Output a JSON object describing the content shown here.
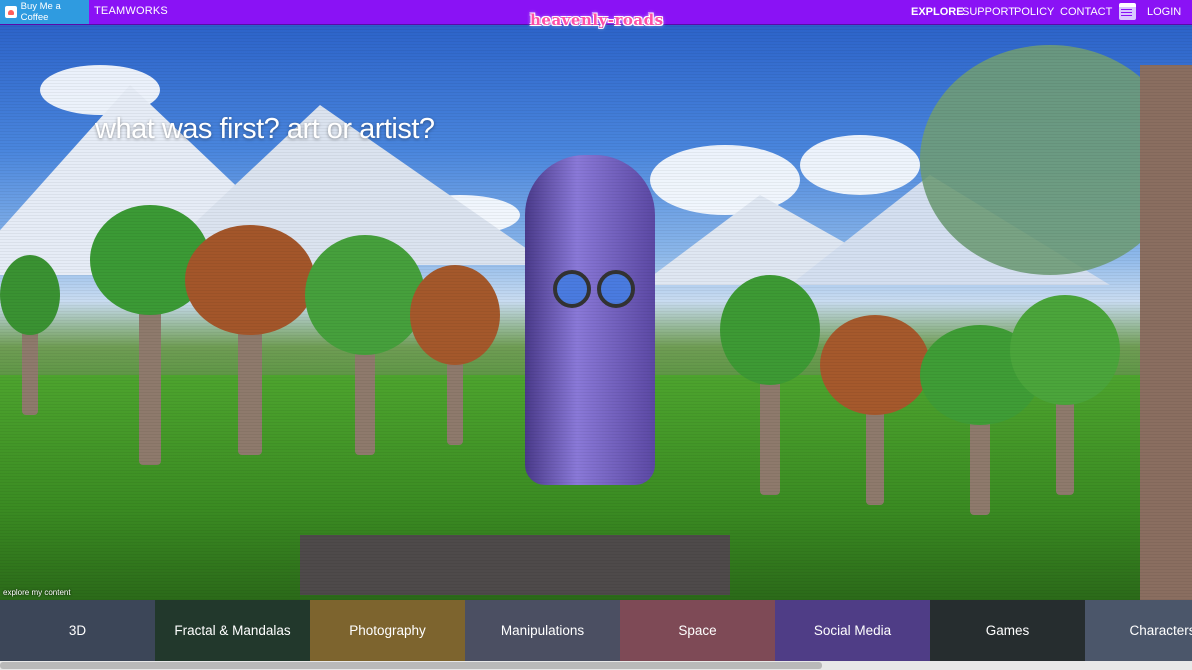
{
  "topbar": {
    "bmc_label": "Buy Me a Coffee",
    "teamworks_label": "TEAMWORKS",
    "logo_text": "heavenly-roads",
    "nav": {
      "explore": "EXPLORE",
      "support": "SUPPORT",
      "policy": "POLICY",
      "contact": "CONTACT",
      "login": "LOGIN"
    },
    "calendar_icon": "calendar-icon"
  },
  "hero": {
    "tagline": "what was first? art or artist?",
    "explore_hint": "explore my content"
  },
  "categories": [
    {
      "label": "3D",
      "color": "#3c4658"
    },
    {
      "label": "Fractal & Mandalas",
      "color": "#22382c"
    },
    {
      "label": "Photography",
      "color": "#7d642e"
    },
    {
      "label": "Manipulations",
      "color": "#4b4f62"
    },
    {
      "label": "Space",
      "color": "#7e4a56"
    },
    {
      "label": "Social Media",
      "color": "#4f3d86"
    },
    {
      "label": "Games",
      "color": "#262d2f"
    },
    {
      "label": "Characters",
      "color": "#4b566a"
    }
  ],
  "colors": {
    "topbar": "#8a12f5",
    "bmc": "#2f9be0",
    "logo": "#ff4fa8"
  }
}
